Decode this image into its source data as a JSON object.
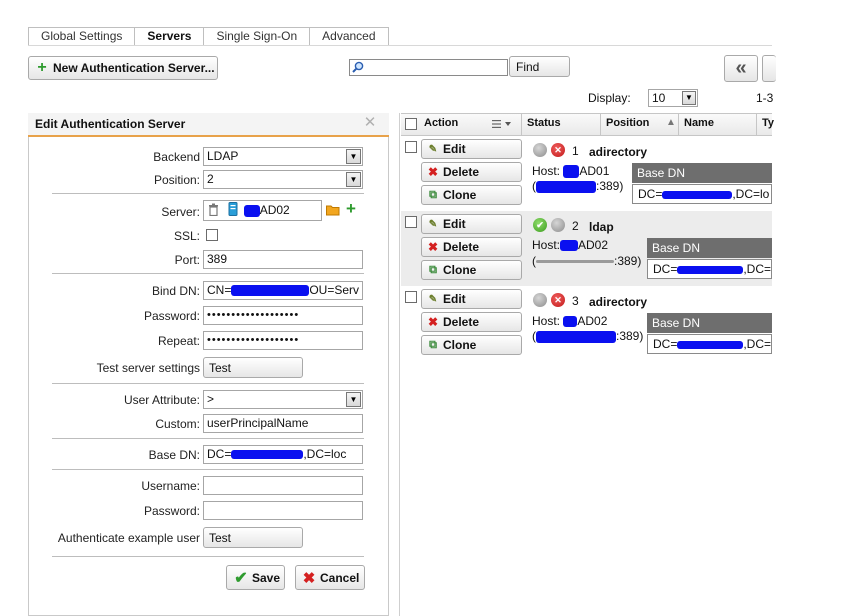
{
  "tabs": [
    "Global Settings",
    "Servers",
    "Single Sign-On",
    "Advanced"
  ],
  "toolbar": {
    "new_server_label": "New Authentication Server...",
    "search_value": "",
    "find_label": "Find",
    "first_page_label": "«"
  },
  "paging": {
    "display_label": "Display:",
    "display_value": "10",
    "range_text": "1-3"
  },
  "panel": {
    "title": "Edit Authentication Server",
    "backend_label": "Backend",
    "backend_value": "LDAP",
    "position_label": "Position:",
    "position_value": "2",
    "server_label": "Server:",
    "server_name_prefix": "",
    "server_name_suffix": "AD02",
    "ssl_label": "SSL:",
    "port_label": "Port:",
    "port_value": "389",
    "bind_dn_label": "Bind DN:",
    "bind_dn_start": "CN=",
    "bind_dn_end": "OU=Serv",
    "password_label": "Password:",
    "password_value": "•••••••••••••••••••",
    "repeat_label": "Repeat:",
    "repeat_value": "•••••••••••••••••••",
    "test_settings_label": "Test server settings",
    "test_button": "Test",
    "user_attr_label": "User Attribute:",
    "user_attr_value": ">",
    "custom_label": "Custom:",
    "custom_value": "userPrincipalName",
    "base_dn_label": "Base DN:",
    "base_dn_start": "DC=",
    "base_dn_end": ",DC=loc",
    "username_label": "Username:",
    "password2_label": "Password:",
    "auth_example_label": "Authenticate example user",
    "test_button_2": "Test",
    "save_label": "Save",
    "cancel_label": "Cancel"
  },
  "grid": {
    "columns": [
      "Action",
      "Status",
      "Position",
      "Name",
      "Ty"
    ],
    "edit_label": "Edit",
    "delete_label": "Delete",
    "clone_label": "Clone",
    "base_dn_header": "Base DN",
    "rows": [
      {
        "position": "1",
        "name": "adirectory",
        "host_prefix": "Host: ",
        "host_suffix": "AD01",
        "port_text": ":389)",
        "base_dn_start": "DC=",
        "base_dn_end": ",DC=lo"
      },
      {
        "position": "2",
        "name": "ldap",
        "host_prefix": "Host:",
        "host_suffix": "AD02",
        "port_text": ":389)",
        "base_dn_start": "DC=",
        "base_dn_end": ",DC="
      },
      {
        "position": "3",
        "name": "adirectory",
        "host_prefix": "Host: ",
        "host_suffix": "AD02",
        "port_text": ":389)",
        "base_dn_start": "DC=",
        "base_dn_end": ",DC="
      }
    ]
  },
  "colors": {
    "accent_orange": "#e8a24a",
    "redaction": "#0a10f0",
    "ok_green": "#3c9d1f",
    "error_red": "#c21b1b"
  }
}
